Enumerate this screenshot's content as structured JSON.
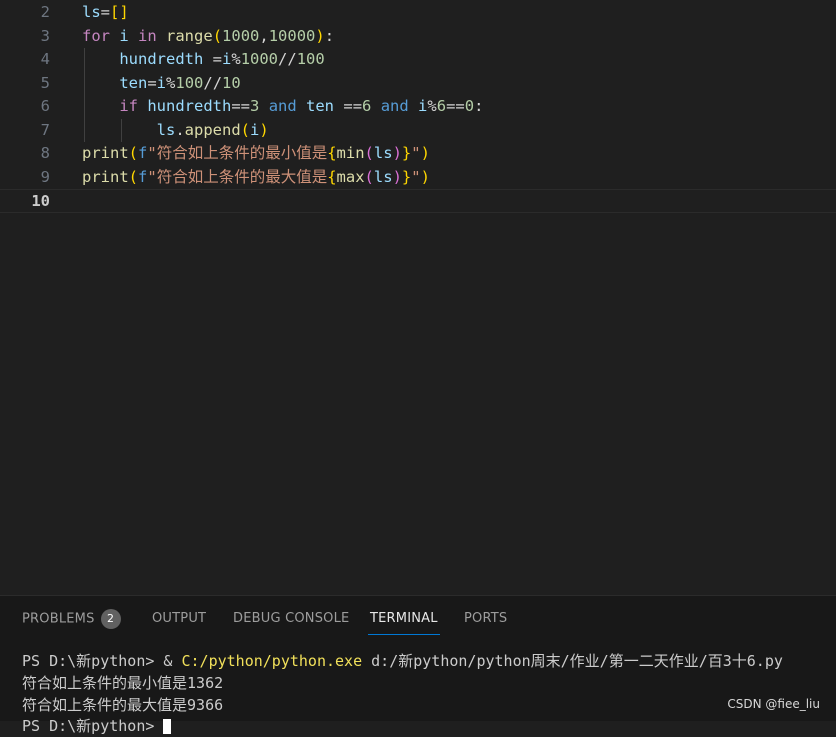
{
  "editor": {
    "lines": [
      {
        "n": "2",
        "code": [
          {
            "t": "ls",
            "c": "var"
          },
          {
            "t": "=",
            "c": "op"
          },
          {
            "t": "[]",
            "c": "br1"
          }
        ]
      },
      {
        "n": "3",
        "code": [
          {
            "t": "for",
            "c": "kw"
          },
          {
            "t": " i ",
            "c": "var"
          },
          {
            "t": "in",
            "c": "kw"
          },
          {
            "t": " ",
            "c": "op"
          },
          {
            "t": "range",
            "c": "fn"
          },
          {
            "t": "(",
            "c": "br1"
          },
          {
            "t": "1000",
            "c": "num"
          },
          {
            "t": ",",
            "c": "op"
          },
          {
            "t": "10000",
            "c": "num"
          },
          {
            "t": ")",
            "c": "br1"
          },
          {
            "t": ":",
            "c": "op"
          }
        ]
      },
      {
        "n": "4",
        "code": [
          {
            "t": "    hundredth ",
            "c": "var"
          },
          {
            "t": "=",
            "c": "op"
          },
          {
            "t": "i",
            "c": "var"
          },
          {
            "t": "%",
            "c": "op"
          },
          {
            "t": "1000",
            "c": "num"
          },
          {
            "t": "//",
            "c": "op"
          },
          {
            "t": "100",
            "c": "num"
          }
        ]
      },
      {
        "n": "5",
        "code": [
          {
            "t": "    ten",
            "c": "var"
          },
          {
            "t": "=",
            "c": "op"
          },
          {
            "t": "i",
            "c": "var"
          },
          {
            "t": "%",
            "c": "op"
          },
          {
            "t": "100",
            "c": "num"
          },
          {
            "t": "//",
            "c": "op"
          },
          {
            "t": "10",
            "c": "num"
          }
        ]
      },
      {
        "n": "6",
        "code": [
          {
            "t": "    ",
            "c": "op"
          },
          {
            "t": "if",
            "c": "kw"
          },
          {
            "t": " hundredth",
            "c": "var"
          },
          {
            "t": "==",
            "c": "op"
          },
          {
            "t": "3",
            "c": "num"
          },
          {
            "t": " ",
            "c": "op"
          },
          {
            "t": "and",
            "c": "kwb"
          },
          {
            "t": " ten ",
            "c": "var"
          },
          {
            "t": "==",
            "c": "op"
          },
          {
            "t": "6",
            "c": "num"
          },
          {
            "t": " ",
            "c": "op"
          },
          {
            "t": "and",
            "c": "kwb"
          },
          {
            "t": " i",
            "c": "var"
          },
          {
            "t": "%",
            "c": "op"
          },
          {
            "t": "6",
            "c": "num"
          },
          {
            "t": "==",
            "c": "op"
          },
          {
            "t": "0",
            "c": "num"
          },
          {
            "t": ":",
            "c": "op"
          }
        ]
      },
      {
        "n": "7",
        "code": [
          {
            "t": "        ls",
            "c": "var"
          },
          {
            "t": ".",
            "c": "op"
          },
          {
            "t": "append",
            "c": "fn"
          },
          {
            "t": "(",
            "c": "br1"
          },
          {
            "t": "i",
            "c": "var"
          },
          {
            "t": ")",
            "c": "br1"
          }
        ]
      },
      {
        "n": "8",
        "code": [
          {
            "t": "print",
            "c": "fn"
          },
          {
            "t": "(",
            "c": "br1"
          },
          {
            "t": "f",
            "c": "kwb"
          },
          {
            "t": "\"符合如上条件的最小值是",
            "c": "str"
          },
          {
            "t": "{",
            "c": "br1"
          },
          {
            "t": "min",
            "c": "fn"
          },
          {
            "t": "(",
            "c": "br2"
          },
          {
            "t": "ls",
            "c": "var"
          },
          {
            "t": ")",
            "c": "br2"
          },
          {
            "t": "}",
            "c": "br1"
          },
          {
            "t": "\"",
            "c": "str"
          },
          {
            "t": ")",
            "c": "br1"
          }
        ]
      },
      {
        "n": "9",
        "code": [
          {
            "t": "print",
            "c": "fn"
          },
          {
            "t": "(",
            "c": "br1"
          },
          {
            "t": "f",
            "c": "kwb"
          },
          {
            "t": "\"符合如上条件的最大值是",
            "c": "str"
          },
          {
            "t": "{",
            "c": "br1"
          },
          {
            "t": "max",
            "c": "fn"
          },
          {
            "t": "(",
            "c": "br2"
          },
          {
            "t": "ls",
            "c": "var"
          },
          {
            "t": ")",
            "c": "br2"
          },
          {
            "t": "}",
            "c": "br1"
          },
          {
            "t": "\"",
            "c": "str"
          },
          {
            "t": ")",
            "c": "br1"
          }
        ]
      },
      {
        "n": "10",
        "code": [],
        "active": true
      }
    ]
  },
  "panel": {
    "tabs": [
      {
        "label": "PROBLEMS",
        "badge": "2"
      },
      {
        "label": "OUTPUT"
      },
      {
        "label": "DEBUG CONSOLE"
      },
      {
        "label": "TERMINAL",
        "active": true
      },
      {
        "label": "PORTS"
      }
    ],
    "terminal": {
      "prompt": "PS D:\\新python> & ",
      "exe": "C:/python/python.exe",
      "args": " d:/新python/python周末/作业/第一二天作业/百3十6.py",
      "out1": "符合如上条件的最小值是1362",
      "out2": "符合如上条件的最大值是9366",
      "prompt2": "PS D:\\新python> "
    },
    "watermark": "CSDN @fiee_liu"
  },
  "colors": {
    "accent": "#0078d4",
    "background": "#1f1f1f"
  }
}
